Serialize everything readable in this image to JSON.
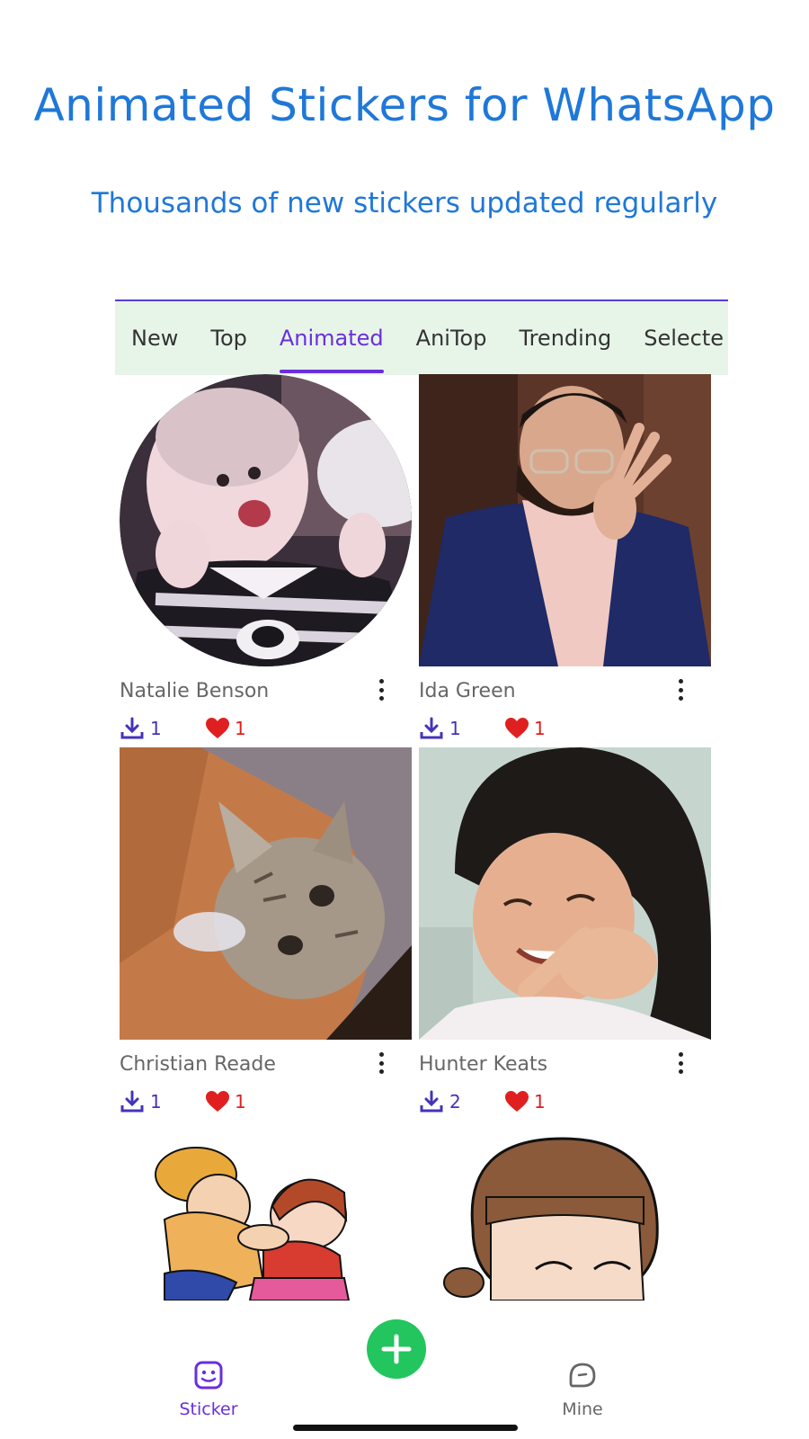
{
  "header": {
    "title": "Animated Stickers for WhatsApp",
    "subtitle": "Thousands of new stickers updated regularly"
  },
  "tabs": [
    {
      "label": "New",
      "active": false
    },
    {
      "label": "Top",
      "active": false
    },
    {
      "label": "Animated",
      "active": true
    },
    {
      "label": "AniTop",
      "active": false
    },
    {
      "label": "Trending",
      "active": false
    },
    {
      "label": "Selecte",
      "active": false
    }
  ],
  "stickers": [
    {
      "name": "Natalie Benson",
      "downloads": "1",
      "likes": "1",
      "shape": "circle",
      "image": "baby cheering photo"
    },
    {
      "name": "Ida Green",
      "downloads": "1",
      "likes": "1",
      "shape": "square",
      "image": "man in suit photo"
    },
    {
      "name": "Christian Reade",
      "downloads": "1",
      "likes": "1",
      "shape": "square",
      "image": "cat photo"
    },
    {
      "name": "Hunter Keats",
      "downloads": "2",
      "likes": "1",
      "shape": "square",
      "image": "girl pointing photo"
    },
    {
      "name": "",
      "image": "cartoon kids"
    },
    {
      "name": "",
      "image": "cartoon girl face"
    }
  ],
  "bottom_nav": {
    "sticker_label": "Sticker",
    "mine_label": "Mine"
  },
  "colors": {
    "accent": "#6a2ee0",
    "title": "#1f78d8",
    "tab_bg": "#e7f5e8",
    "fab": "#22c55e",
    "heart": "#e02020",
    "download": "#4433bb"
  }
}
